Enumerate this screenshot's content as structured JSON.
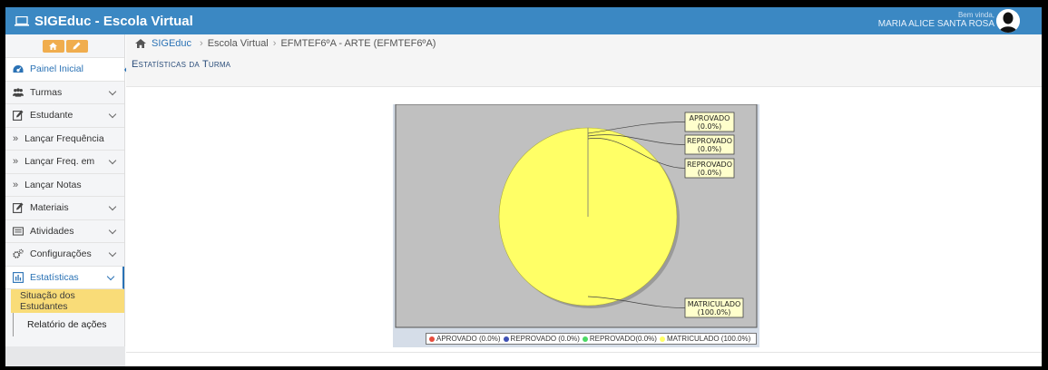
{
  "app": {
    "title": "SIGEduc - Escola Virtual"
  },
  "user": {
    "greeting": "Bem vinda,",
    "name": "MARIA ALICE SANTA ROSA"
  },
  "breadcrumb": {
    "root": "SIGEduc",
    "sep": "›",
    "level1": "Escola Virtual",
    "level2": "EFMTEF6ºA - ARTE (EFMTEF6ºA)"
  },
  "page": {
    "title": "Estatísticas da Turma"
  },
  "sidebar": {
    "items": [
      {
        "label": "Painel Inicial",
        "icon": "dashboard-icon"
      },
      {
        "label": "Turmas",
        "icon": "users-icon"
      },
      {
        "label": "Estudante",
        "icon": "edit-icon"
      },
      {
        "label": "Lançar Frequência",
        "icon": "double-chevron-icon"
      },
      {
        "label": "Lançar Freq. em",
        "icon": "double-chevron-icon"
      },
      {
        "label": "Lançar Notas",
        "icon": "double-chevron-icon"
      },
      {
        "label": "Materiais",
        "icon": "edit-icon"
      },
      {
        "label": "Atividades",
        "icon": "list-icon"
      },
      {
        "label": "Configurações",
        "icon": "gears-icon"
      },
      {
        "label": "Estatísticas",
        "icon": "bar-chart-icon"
      }
    ],
    "subitems": [
      {
        "label": "Situação dos Estudantes"
      },
      {
        "label": "Relatório de ações"
      }
    ]
  },
  "colors": {
    "topbar": "#3b88c3",
    "accent": "#2a72b5",
    "highlight": "#f9dc78",
    "toolbtn": "#f0ad4e"
  },
  "chart_data": {
    "type": "pie",
    "series": [
      {
        "name": "APROVADO",
        "value": 0.0,
        "pct": "(0.0%)",
        "color": "#e74c3c"
      },
      {
        "name": "REPROVADO",
        "value": 0.0,
        "pct": "(0.0%)",
        "color": "#3f51b5"
      },
      {
        "name": "REPROVADO",
        "value": 0.0,
        "pct": "(0.0%)",
        "color": "#4cd964"
      },
      {
        "name": "MATRICULADO",
        "value": 100.0,
        "pct": "(100.0%)",
        "color": "#ffff66"
      }
    ],
    "legend": [
      "APROVADO (0.0%)",
      "REPROVADO (0.0%)",
      "REPROVADO(0.0%)",
      "MATRICULADO (100.0%)"
    ],
    "legend_position": "bottom"
  }
}
